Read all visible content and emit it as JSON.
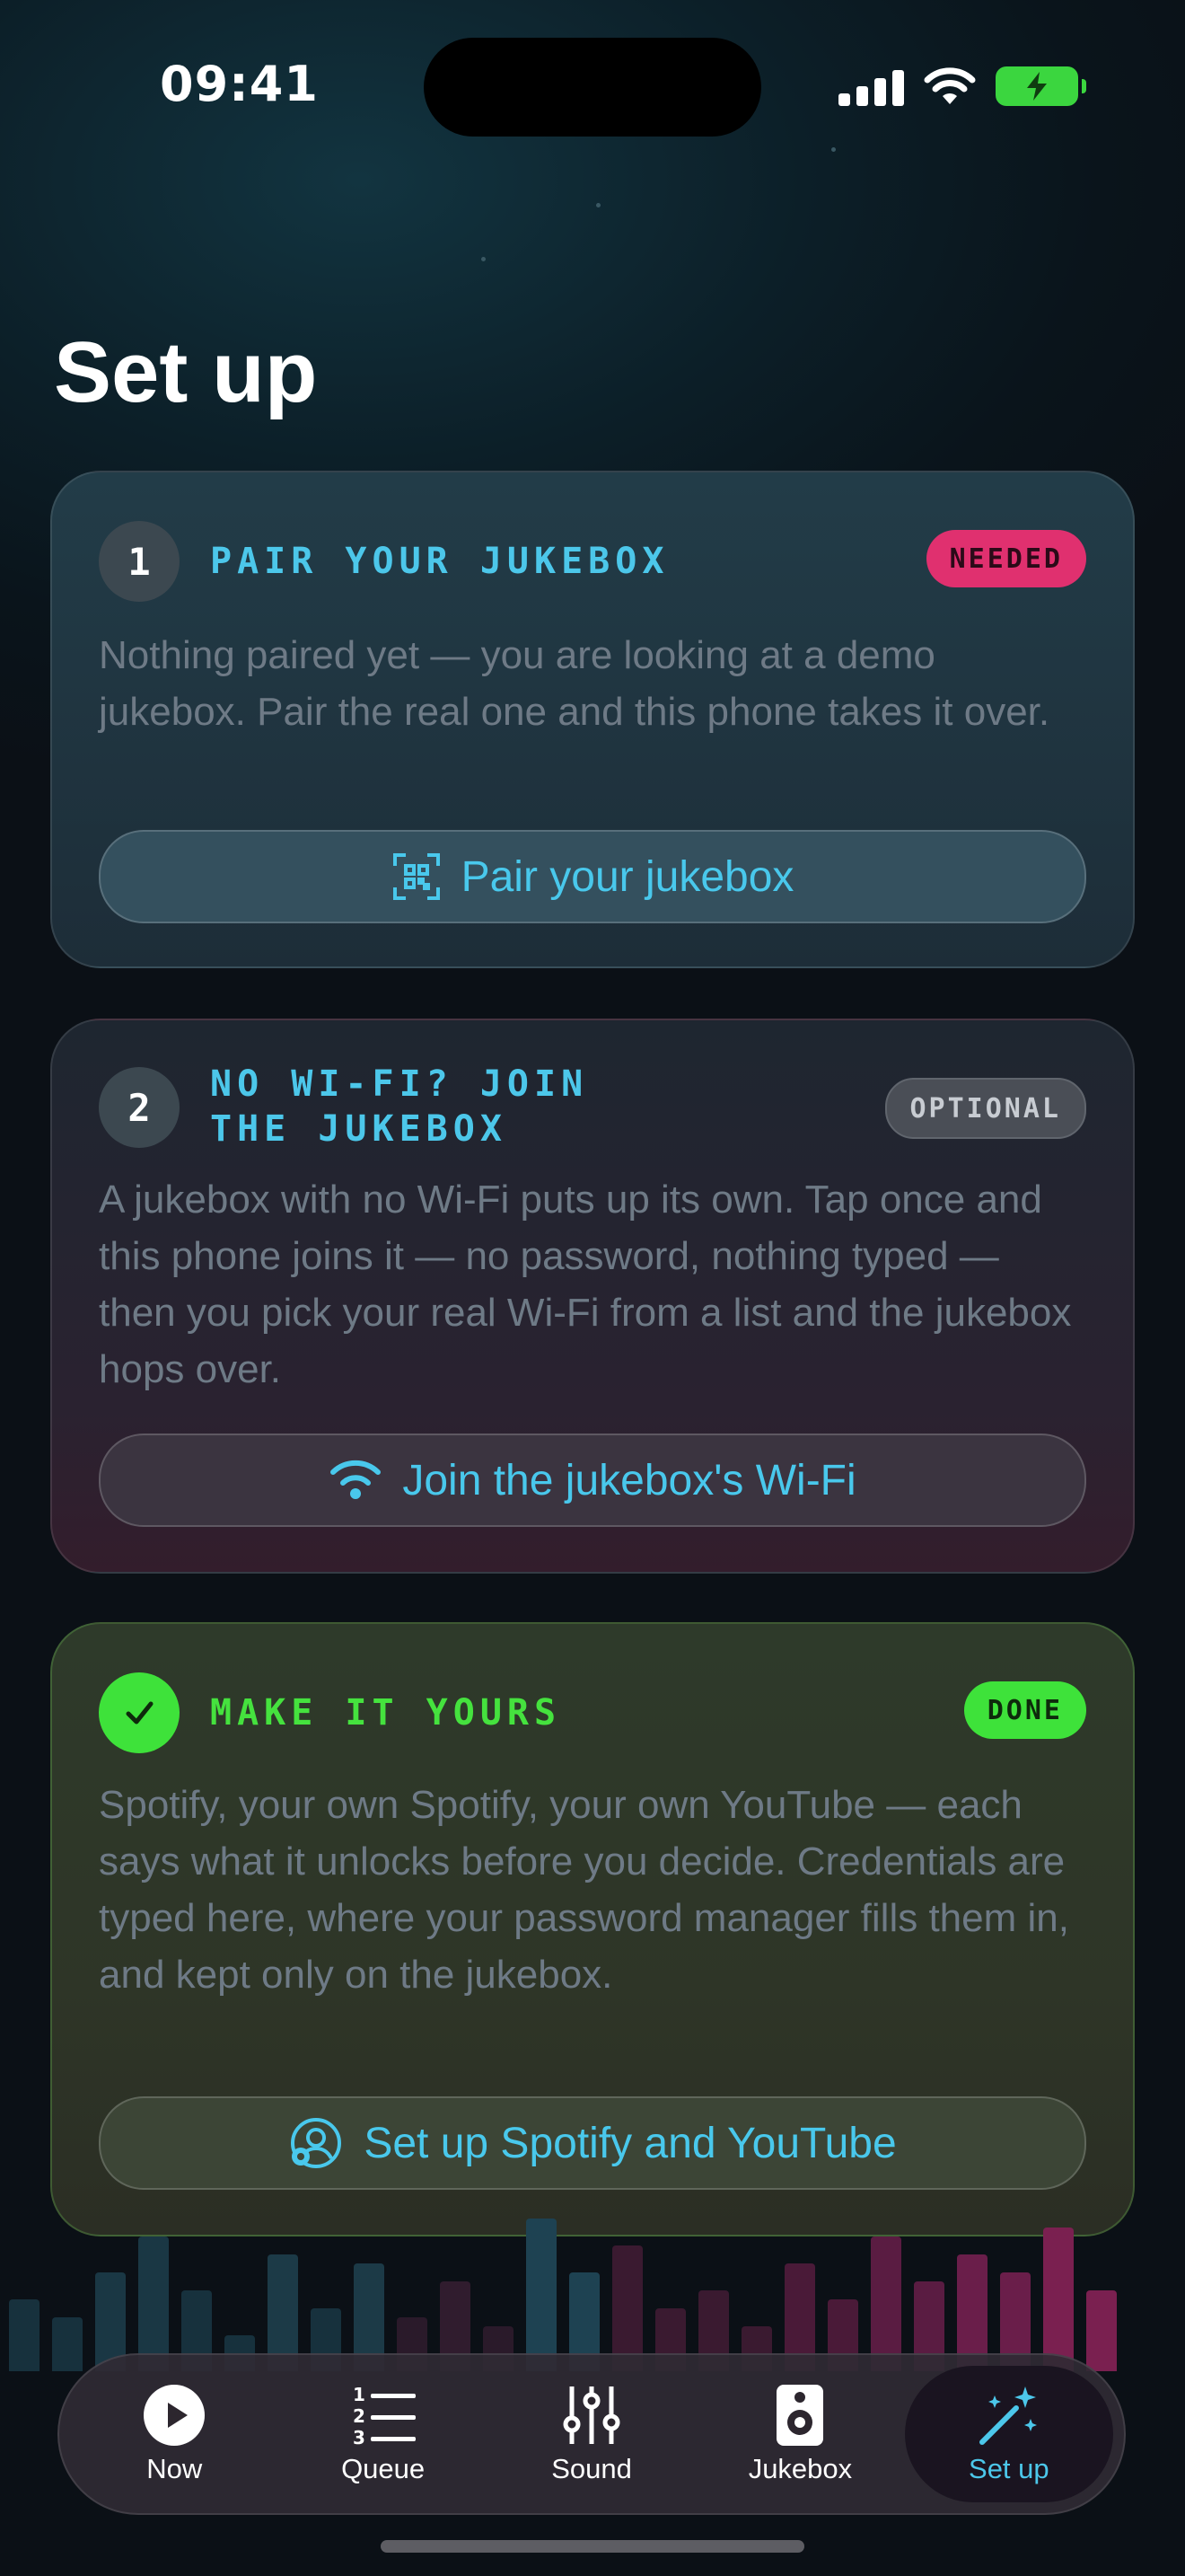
{
  "status_bar": {
    "time": "09:41"
  },
  "page": {
    "title": "Set up"
  },
  "cards": [
    {
      "step": "1",
      "heading_lines": [
        "PAIR YOUR JUKEBOX"
      ],
      "badge": "NEEDED",
      "body": "Nothing paired yet — you are looking at a demo jukebox. Pair the real one and this phone takes it over.",
      "action_label": "Pair your jukebox",
      "action_icon": "qr-code-icon"
    },
    {
      "step": "2",
      "heading_lines": [
        "NO WI-FI? JOIN",
        "THE JUKEBOX"
      ],
      "badge": "OPTIONAL",
      "body": "A jukebox with no Wi-Fi puts up its own. Tap once and this phone joins it — no password, nothing typed — then you pick your real Wi-Fi from a list and the jukebox hops over.",
      "action_label": "Join the jukebox's Wi-Fi",
      "action_icon": "wifi-icon"
    },
    {
      "step": "check",
      "heading_lines": [
        "MAKE IT YOURS"
      ],
      "badge": "DONE",
      "body": "Spotify, your own Spotify, your own YouTube — each says what it unlocks before you decide. Credentials are typed here, where your password manager fills them in, and kept only on the jukebox.",
      "action_label": "Set up Spotify and YouTube",
      "action_icon": "account-settings-icon"
    }
  ],
  "tabs": [
    {
      "label": "Now",
      "icon": "play-circle-icon",
      "active": false
    },
    {
      "label": "Queue",
      "icon": "numbered-list-icon",
      "active": false
    },
    {
      "label": "Sound",
      "icon": "sliders-icon",
      "active": false
    },
    {
      "label": "Jukebox",
      "icon": "speaker-icon",
      "active": false
    },
    {
      "label": "Set up",
      "icon": "magic-wand-icon",
      "active": true
    }
  ],
  "colors": {
    "accent": "#4cc7ea",
    "needed": "#e0306f",
    "done": "#3ee23a"
  }
}
